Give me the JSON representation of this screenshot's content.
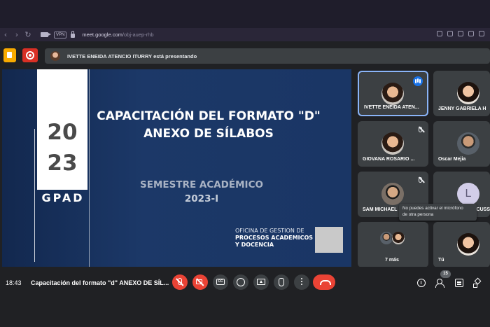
{
  "browser": {
    "url_domain": "meet.google.com",
    "url_path": "/obj-auep-rhb",
    "vpn_label": "VPN",
    "back_glyph": "‹",
    "forward_glyph": "›",
    "reload_glyph": "↻"
  },
  "header": {
    "presenting_text": "IVETTE ENEIDA ATENCIO ITURRY está presentando"
  },
  "slide": {
    "year_top": "20",
    "year_bottom": "23",
    "brand": "GPAD",
    "title_line1": "CAPACITACIÓN DEL FORMATO \"D\"",
    "title_line2": "ANEXO DE SÍLABOS",
    "subtitle_line1": "SEMESTRE ACADÉMICO",
    "subtitle_line2": "2023-I",
    "office_line1": "OFICINA DE GESTION DE",
    "office_line2": "PROCESOS ACADEMICOS",
    "office_line3": "Y DOCENCIA"
  },
  "participants": [
    {
      "name": "IVETTE ENEIDA ATEN...",
      "speaking": true
    },
    {
      "name": "JENNY GABRIELA H",
      "muted": false
    },
    {
      "name": "GIOVANA ROSARIO ...",
      "muted": true
    },
    {
      "name": "Oscar Mejia",
      "muted": false
    },
    {
      "name": "SAM MICHAEL",
      "muted": true
    },
    {
      "name": "CUSS",
      "avatar_letter": "L"
    },
    {
      "name": "7 más"
    },
    {
      "name": "Tú"
    }
  ],
  "tooltip": {
    "line1": "No puedes activar el micrófono",
    "line2": "de otra persona"
  },
  "bottom_bar": {
    "time": "18:43",
    "meeting_title": "Capacitación del formato \"d\" ANEXO DE SÍL...",
    "participants_count": "15",
    "cc_label": "CC"
  },
  "colors": {
    "end_call": "#ea4335",
    "active_speaker_border": "#8ab4f8",
    "slide_background": "#1b3766",
    "record_button": "#d93025",
    "activities_button": "#f9ab00"
  }
}
